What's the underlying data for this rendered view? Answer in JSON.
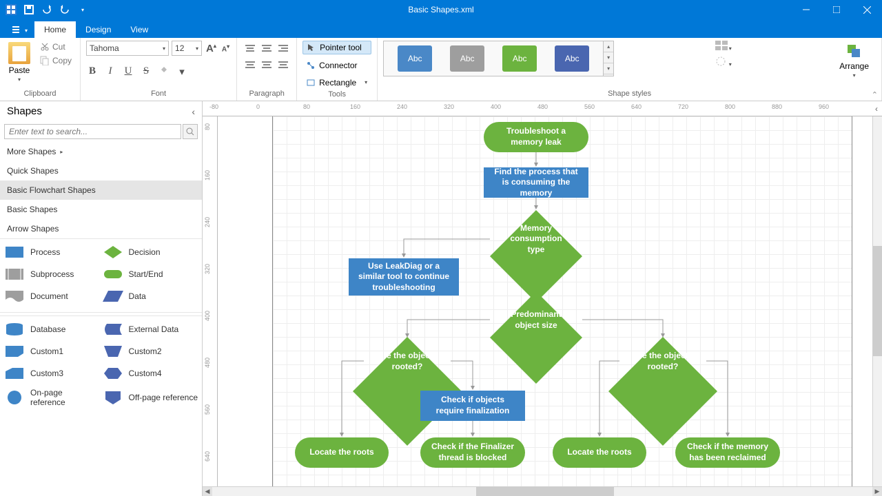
{
  "title_bar": {
    "title": "Basic Shapes.xml"
  },
  "tabs": {
    "file_icon": "list-icon",
    "home": "Home",
    "design": "Design",
    "view": "View"
  },
  "ribbon": {
    "clipboard": {
      "paste": "Paste",
      "cut": "Cut",
      "copy": "Copy",
      "label": "Clipboard"
    },
    "font": {
      "family": "Tahoma",
      "size": "12",
      "label": "Font"
    },
    "paragraph": {
      "label": "Paragraph"
    },
    "tools": {
      "pointer": "Pointer tool",
      "connector": "Connector",
      "rectangle": "Rectangle",
      "label": "Tools"
    },
    "styles": {
      "sample": "Abc",
      "label": "Shape styles"
    },
    "arrange": {
      "label": "Arrange"
    }
  },
  "shapes_pane": {
    "title": "Shapes",
    "search_placeholder": "Enter text to search...",
    "more": "More Shapes",
    "categories": {
      "quick": "Quick Shapes",
      "flow": "Basic Flowchart Shapes",
      "basic": "Basic Shapes",
      "arrow": "Arrow Shapes"
    },
    "items1": {
      "process": "Process",
      "decision": "Decision",
      "subprocess": "Subprocess",
      "startend": "Start/End",
      "document": "Document",
      "data": "Data"
    },
    "items2": {
      "database": "Database",
      "extdata": "External Data",
      "custom1": "Custom1",
      "custom2": "Custom2",
      "custom3": "Custom3",
      "custom4": "Custom4",
      "onpage": "On-page reference",
      "offpage": "Off-page reference"
    }
  },
  "canvas": {
    "troubleshoot": "Troubleshoot a memory leak",
    "find_process": "Find the process that is consuming the memory",
    "mem_type": "Memory consumption type",
    "leakdiag": "Use LeakDiag or a similar tool to continue troubleshooting",
    "pred_size": "Predominant object size",
    "rooted1": "Are the objects rooted?",
    "rooted2": "Are the objects rooted?",
    "check_final": "Check if objects require finalization",
    "locate1": "Locate the roots",
    "check_blocked": "Check if the Finalizer thread is blocked",
    "locate2": "Locate the roots",
    "check_reclaimed": "Check if the memory has been reclaimed"
  },
  "ruler_h": [
    "-80",
    "0",
    "80",
    "160",
    "240",
    "320",
    "400",
    "480",
    "560",
    "640",
    "720",
    "800",
    "880",
    "960"
  ],
  "ruler_v": [
    "80",
    "160",
    "240",
    "320",
    "400",
    "480",
    "560",
    "640"
  ]
}
